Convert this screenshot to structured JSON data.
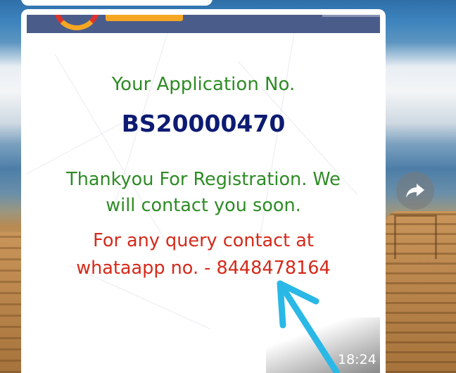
{
  "message": {
    "application_label": "Your Application No.",
    "application_number": "BS20000470",
    "thanks_line_1": "Thankyou For Registration. We",
    "thanks_line_2": "will contact you soon.",
    "query_line_1": "For any query contact at",
    "query_line_2": "whataapp no. - 8448478164",
    "timestamp": "18:24"
  },
  "icons": {
    "forward": "forward-share-icon",
    "annotation": "blue-arrow-annotation"
  },
  "colors": {
    "green_text": "#2e8b25",
    "navy_number": "#0d1b72",
    "red_text": "#d42a1a",
    "banner": "#4a5d8a",
    "annotation_arrow": "#2ab8e6"
  }
}
